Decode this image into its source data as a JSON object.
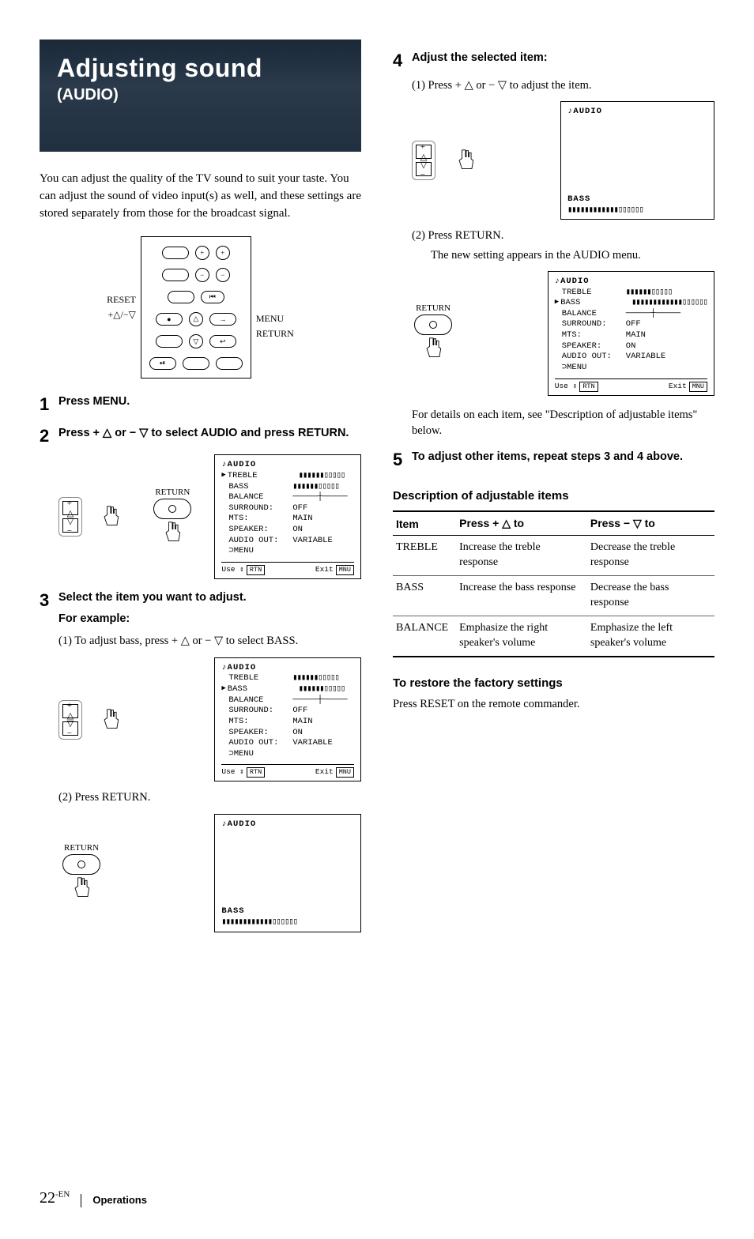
{
  "banner": {
    "title": "Adjusting sound",
    "subtitle": "(AUDIO)"
  },
  "intro": "You can adjust the quality of the TV sound to suit your taste.  You can adjust the sound of video input(s) as well, and these settings are stored separately from those for the broadcast signal.",
  "remote_labels": {
    "reset": "RESET",
    "plusminus": "+△/−▽",
    "menu": "MENU",
    "return": "RETURN"
  },
  "steps": {
    "s1": {
      "num": "1",
      "head": "Press MENU."
    },
    "s2": {
      "num": "2",
      "head": "Press + △ or − ▽ to select AUDIO and press RETURN.",
      "return_label": "RETURN"
    },
    "s3": {
      "num": "3",
      "head": "Select the item you want to adjust.",
      "head2": "For example:",
      "line1": "(1) To adjust bass, press + △ or − ▽ to select BASS.",
      "line2": "(2) Press RETURN.",
      "return_label": "RETURN"
    },
    "s4": {
      "num": "4",
      "head": "Adjust the selected item:",
      "line1": "(1) Press + △ or − ▽ to adjust the item.",
      "line2": "(2) Press RETURN.",
      "line3": "The new setting appears in the AUDIO menu.",
      "return_label": "RETURN",
      "tail": "For details on each item, see \"Description of adjustable items\" below."
    },
    "s5": {
      "num": "5",
      "head": "To adjust other items, repeat steps 3 and 4 above."
    }
  },
  "osd": {
    "title": "♪AUDIO",
    "items": [
      {
        "label": "TREBLE",
        "val": "▮▮▮▮▮▮▯▯▯▯▯"
      },
      {
        "label": "BASS",
        "val": "▮▮▮▮▮▮▯▯▯▯▯"
      },
      {
        "label": "BALANCE",
        "val": "─────┼─────"
      },
      {
        "label": "SURROUND:",
        "val": "OFF"
      },
      {
        "label": "MTS:",
        "val": "MAIN"
      },
      {
        "label": "SPEAKER:",
        "val": "ON"
      },
      {
        "label": "AUDIO OUT:",
        "val": "VARIABLE"
      },
      {
        "label": "⊃MENU",
        "val": ""
      }
    ],
    "foot_use": "Use  ⇕",
    "foot_use_key": "RTN",
    "foot_exit": "Exit",
    "foot_exit_key": "MNU",
    "bass_label": "BASS",
    "bass_bar": "▮▮▮▮▮▮▮▮▮▮▮▮▯▯▯▯▯▯"
  },
  "osd_pointers": {
    "step2": "TREBLE",
    "step3_1": "BASS",
    "step4_2": "BASS"
  },
  "desc_section": {
    "title": "Description of adjustable items",
    "headers": {
      "item": "Item",
      "up": "Press + △ to",
      "down": "Press − ▽ to"
    },
    "rows": [
      {
        "item": "TREBLE",
        "up": "Increase the treble response",
        "down": "Decrease the treble response"
      },
      {
        "item": "BASS",
        "up": "Increase the bass response",
        "down": "Decrease the bass response"
      },
      {
        "item": "BALANCE",
        "up": "Emphasize the right speaker's volume",
        "down": "Emphasize the left speaker's volume"
      }
    ]
  },
  "restore": {
    "title": "To restore the factory settings",
    "text": "Press RESET on the remote commander."
  },
  "footer": {
    "page": "22",
    "lang": "-EN",
    "section": "Operations"
  }
}
